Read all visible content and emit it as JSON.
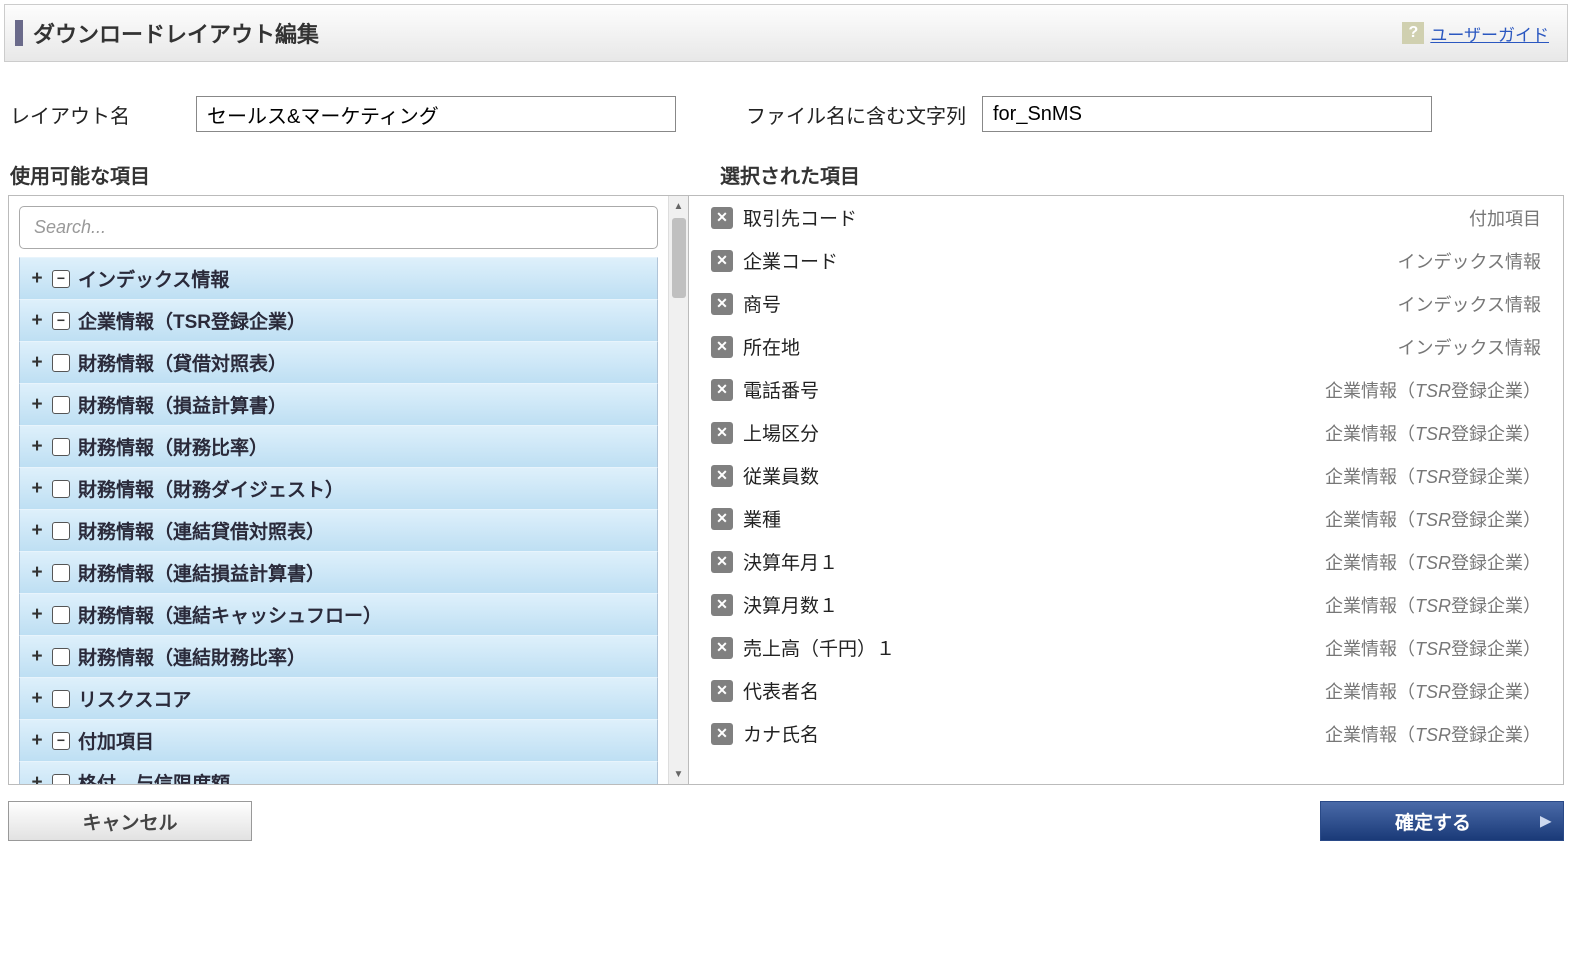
{
  "header": {
    "title": "ダウンロードレイアウト編集",
    "help_icon": "?",
    "user_guide": "ユーザーガイド"
  },
  "form": {
    "layout_label": "レイアウト名",
    "layout_value": "セールス&マーケティング",
    "filename_label": "ファイル名に含む文字列",
    "filename_value": "for_SnMS"
  },
  "available": {
    "header": "使用可能な項目",
    "search_placeholder": "Search...",
    "categories": [
      {
        "label": "インデックス情報",
        "box": "minus"
      },
      {
        "label": "企業情報（TSR登録企業）",
        "box": "minus"
      },
      {
        "label": "財務情報（貸借対照表）",
        "box": "check"
      },
      {
        "label": "財務情報（損益計算書）",
        "box": "check"
      },
      {
        "label": "財務情報（財務比率）",
        "box": "check"
      },
      {
        "label": "財務情報（財務ダイジェスト）",
        "box": "check"
      },
      {
        "label": "財務情報（連結貸借対照表）",
        "box": "check"
      },
      {
        "label": "財務情報（連結損益計算書）",
        "box": "check"
      },
      {
        "label": "財務情報（連結キャッシュフロー）",
        "box": "check"
      },
      {
        "label": "財務情報（連結財務比率）",
        "box": "check"
      },
      {
        "label": "リスクスコア",
        "box": "check"
      },
      {
        "label": "付加項目",
        "box": "minus"
      },
      {
        "label": "格付　与信限度額",
        "box": "check",
        "truncated": true
      }
    ]
  },
  "selected": {
    "header": "選択された項目",
    "items": [
      {
        "name": "取引先コード",
        "category": "付加項目",
        "tsr": false
      },
      {
        "name": "企業コード",
        "category": "インデックス情報",
        "tsr": false
      },
      {
        "name": "商号",
        "category": "インデックス情報",
        "tsr": false
      },
      {
        "name": "所在地",
        "category": "インデックス情報",
        "tsr": false
      },
      {
        "name": "電話番号",
        "category": "企業情報（TSR登録企業）",
        "tsr": true
      },
      {
        "name": "上場区分",
        "category": "企業情報（TSR登録企業）",
        "tsr": true
      },
      {
        "name": "従業員数",
        "category": "企業情報（TSR登録企業）",
        "tsr": true
      },
      {
        "name": "業種",
        "category": "企業情報（TSR登録企業）",
        "tsr": true
      },
      {
        "name": "決算年月１",
        "category": "企業情報（TSR登録企業）",
        "tsr": true
      },
      {
        "name": "決算月数１",
        "category": "企業情報（TSR登録企業）",
        "tsr": true
      },
      {
        "name": "売上高（千円）１",
        "category": "企業情報（TSR登録企業）",
        "tsr": true
      },
      {
        "name": "代表者名",
        "category": "企業情報（TSR登録企業）",
        "tsr": true
      },
      {
        "name": "カナ氏名",
        "category": "企業情報（TSR登録企業）",
        "tsr": true
      }
    ]
  },
  "footer": {
    "cancel": "キャンセル",
    "confirm": "確定する"
  }
}
